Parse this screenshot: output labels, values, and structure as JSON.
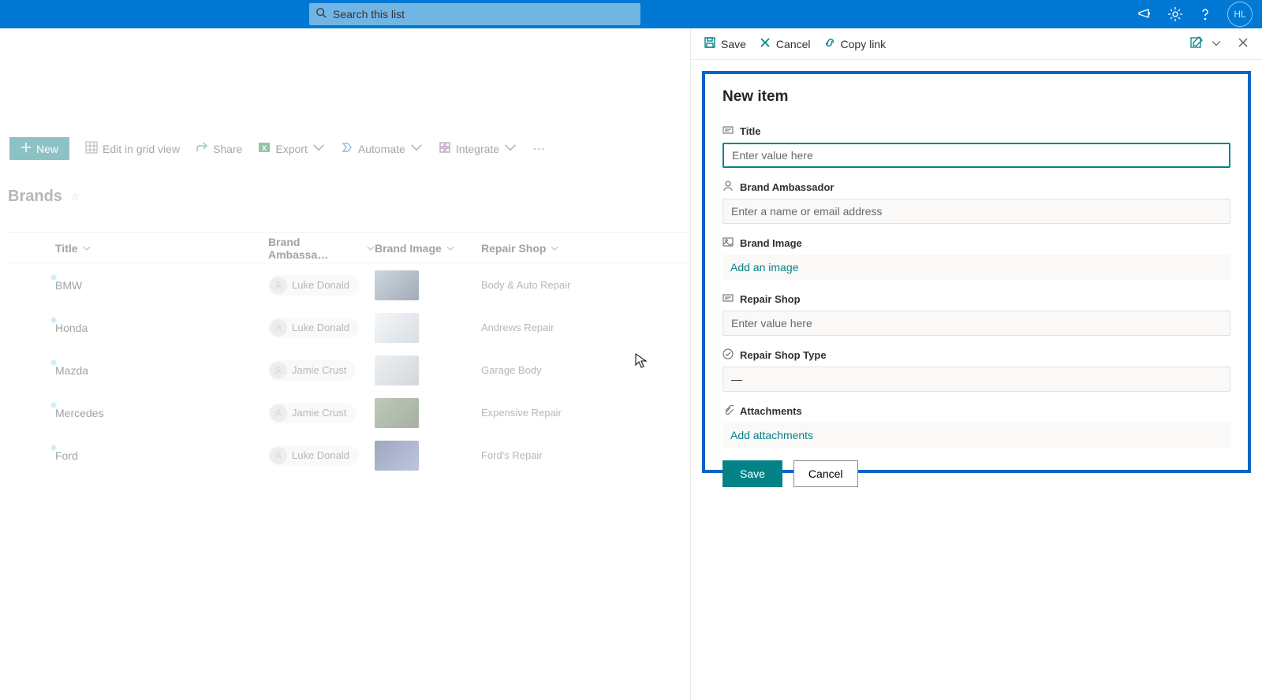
{
  "header": {
    "search_placeholder": "Search this list",
    "avatar_initials": "HL"
  },
  "command_bar": {
    "new_label": "New",
    "edit_grid": "Edit in grid view",
    "share": "Share",
    "export": "Export",
    "automate": "Automate",
    "integrate": "Integrate"
  },
  "list": {
    "title": "Brands",
    "columns": {
      "title": "Title",
      "brand_ambassador": "Brand Ambassa…",
      "brand_image": "Brand Image",
      "repair_shop": "Repair Shop"
    },
    "rows": [
      {
        "title": "BMW",
        "ambassador": "Luke Donald",
        "repair_shop": "Body & Auto Repair",
        "thumb_colors": [
          "#8fa7b8",
          "#2f4660"
        ]
      },
      {
        "title": "Honda",
        "ambassador": "Luke Donald",
        "repair_shop": "Andrews Repair",
        "thumb_colors": [
          "#e8eef2",
          "#a8b6c2"
        ]
      },
      {
        "title": "Mazda",
        "ambassador": "Jamie Crust",
        "repair_shop": "Garage Body",
        "thumb_colors": [
          "#d9dee2",
          "#9ea8b0"
        ]
      },
      {
        "title": "Mercedes",
        "ambassador": "Jamie Crust",
        "repair_shop": "Expensive Repair",
        "thumb_colors": [
          "#6b8a5f",
          "#3c5032"
        ]
      },
      {
        "title": "Ford",
        "ambassador": "Luke Donald",
        "repair_shop": "Ford's Repair",
        "thumb_colors": [
          "#2a3d6e",
          "#6a82b5"
        ]
      }
    ]
  },
  "panel": {
    "save": "Save",
    "cancel": "Cancel",
    "copy_link": "Copy link",
    "form_title": "New item",
    "fields": {
      "title": {
        "label": "Title",
        "placeholder": "Enter value here"
      },
      "brand_ambassador": {
        "label": "Brand Ambassador",
        "placeholder": "Enter a name or email address"
      },
      "brand_image": {
        "label": "Brand Image",
        "action": "Add an image"
      },
      "repair_shop": {
        "label": "Repair Shop",
        "placeholder": "Enter value here"
      },
      "repair_shop_type": {
        "label": "Repair Shop Type",
        "value": "—"
      },
      "attachments": {
        "label": "Attachments",
        "action": "Add attachments"
      }
    },
    "save_btn": "Save",
    "cancel_btn": "Cancel"
  }
}
